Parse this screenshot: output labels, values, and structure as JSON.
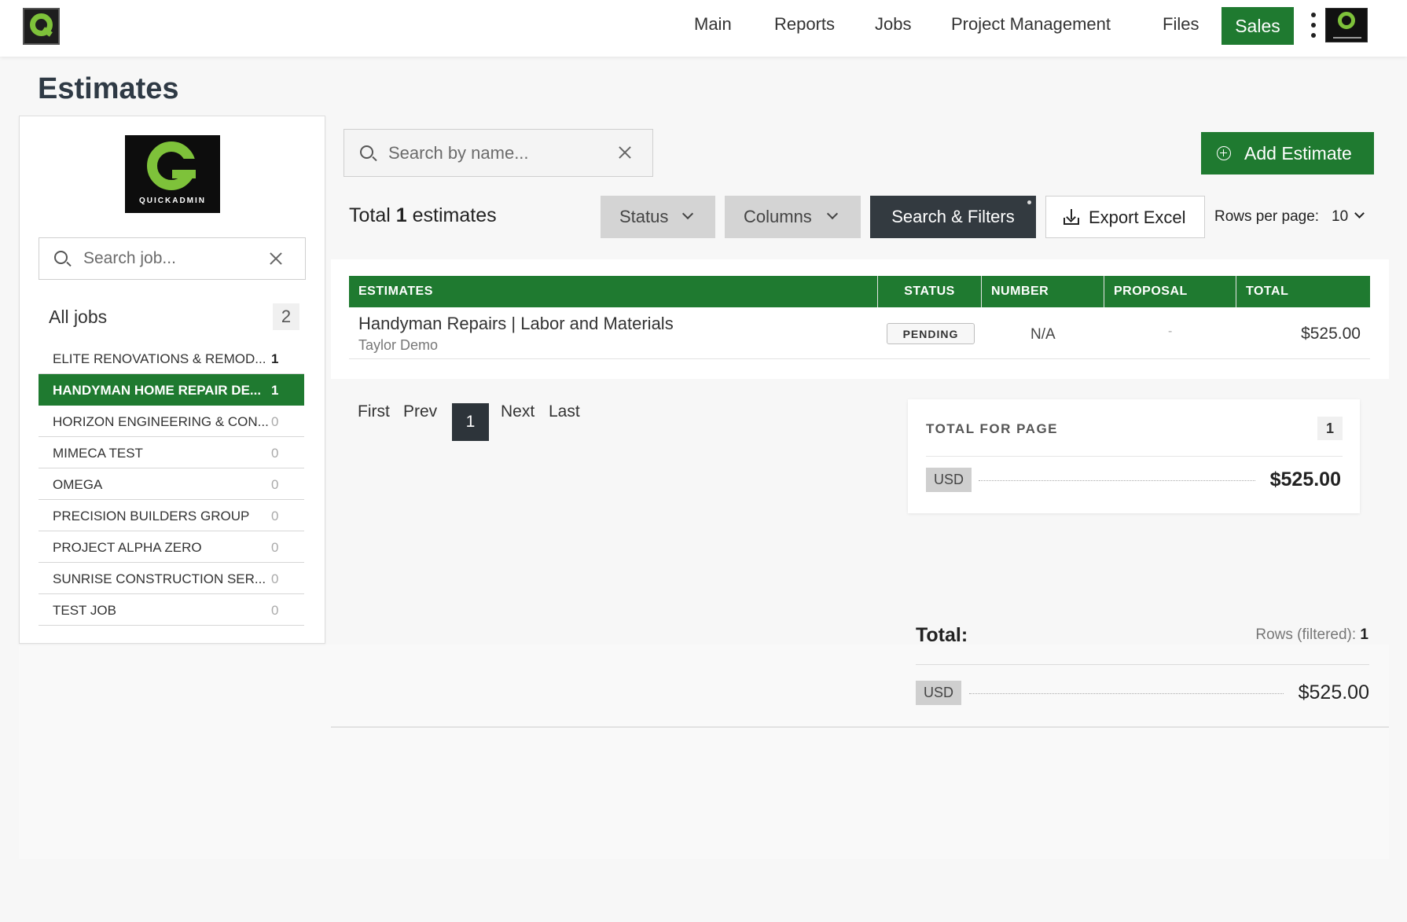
{
  "nav": {
    "items": [
      "Main",
      "Reports",
      "Jobs",
      "Project Management",
      "Files"
    ],
    "active": "Sales",
    "accent": "#1f7a30"
  },
  "page": {
    "title": "Estimates"
  },
  "sidebar": {
    "logo_text": "QUICKADMIN",
    "search_placeholder": "Search job...",
    "all_jobs_label": "All jobs",
    "all_jobs_count": "2",
    "jobs": [
      {
        "label": "ELITE RENOVATIONS & REMOD...",
        "count": "1"
      },
      {
        "label": "HANDYMAN HOME REPAIR DE...",
        "count": "1"
      },
      {
        "label": "HORIZON ENGINEERING & CON...",
        "count": "0"
      },
      {
        "label": "MIMECA TEST",
        "count": "0"
      },
      {
        "label": "OMEGA",
        "count": "0"
      },
      {
        "label": "PRECISION BUILDERS GROUP",
        "count": "0"
      },
      {
        "label": "PROJECT ALPHA ZERO",
        "count": "0"
      },
      {
        "label": "SUNRISE CONSTRUCTION SER...",
        "count": "0"
      },
      {
        "label": "TEST JOB",
        "count": "0"
      }
    ],
    "active_job_index": 1
  },
  "toolbar": {
    "search_placeholder": "Search by name...",
    "add_label": "Add Estimate",
    "total_prefix": "Total",
    "total_count": "1",
    "total_suffix": "estimates",
    "status_label": "Status",
    "columns_label": "Columns",
    "search_filters_label": "Search & Filters",
    "export_label": "Export Excel",
    "rows_per_page_label": "Rows per page:",
    "rows_per_page_value": "10"
  },
  "table": {
    "headers": [
      "ESTIMATES",
      "STATUS",
      "NUMBER",
      "PROPOSAL",
      "TOTAL"
    ],
    "rows": [
      {
        "name": "Handyman Repairs | Labor and Materials",
        "client": "Taylor Demo",
        "status": "PENDING",
        "number": "N/A",
        "proposal": "-",
        "total": "$525.00"
      }
    ]
  },
  "pagination": {
    "first": "First",
    "prev": "Prev",
    "current": "1",
    "next": "Next",
    "last": "Last"
  },
  "page_total": {
    "title": "TOTAL FOR PAGE",
    "count": "1",
    "currency": "USD",
    "amount": "$525.00"
  },
  "grand_total": {
    "label": "Total:",
    "rows_label": "Rows (filtered):",
    "rows_count": "1",
    "currency": "USD",
    "amount": "$525.00"
  }
}
